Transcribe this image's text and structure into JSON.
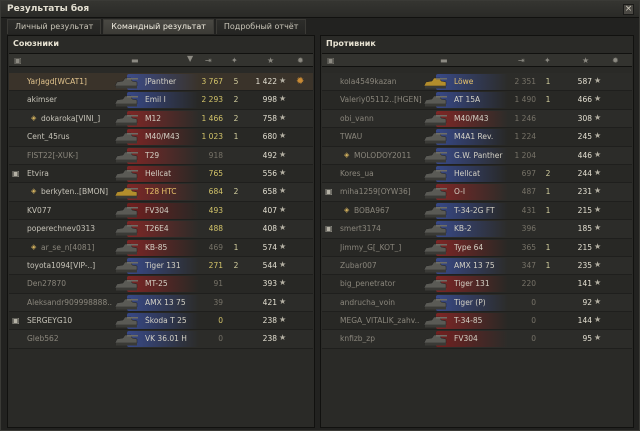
{
  "window": {
    "title": "Результаты боя",
    "close": "×"
  },
  "tabs": [
    {
      "label": "Личный результат",
      "active": false
    },
    {
      "label": "Командный результат",
      "active": true
    },
    {
      "label": "Подробный отчёт",
      "active": false
    }
  ],
  "allies": {
    "title": "Союзники",
    "rows": [
      {
        "name": "YarJagd[WCAT1]",
        "tank": "JPanther",
        "dmg": "3 767",
        "kills": "5",
        "xp": "1 422",
        "star": "★",
        "player": true,
        "medal": "✹",
        "nation": "#3c53a8"
      },
      {
        "name": "akimser",
        "tank": "Emil I",
        "dmg": "2 293",
        "kills": "2",
        "xp": "998",
        "star": "★",
        "nation": "#3c53a8"
      },
      {
        "name": "dokaroka[VINI_]",
        "tank": "M12",
        "dmg": "1 466",
        "kills": "2",
        "xp": "758",
        "star": "★",
        "platoon": true,
        "nation": "#9b2525"
      },
      {
        "name": "Cent_45rus",
        "tank": "M40/M43",
        "dmg": "1 023",
        "kills": "1",
        "xp": "680",
        "star": "★",
        "nation": "#9b2525"
      },
      {
        "name": "FIST22[-XUK-]",
        "tank": "T29",
        "dmg": "918",
        "kills": "",
        "xp": "492",
        "star": "★",
        "dead": true,
        "nation": "#9b2525"
      },
      {
        "name": "Etvira",
        "tank": "Hellcat",
        "dmg": "765",
        "kills": "",
        "xp": "556",
        "star": "★",
        "squad": true,
        "nation": "#9b2525"
      },
      {
        "name": "berkyten..[BMON]",
        "tank": "T28 HTC",
        "dmg": "684",
        "kills": "2",
        "xp": "658",
        "star": "★",
        "platoon": true,
        "elite": true,
        "nation": "#9b2525"
      },
      {
        "name": "KV077",
        "tank": "FV304",
        "dmg": "493",
        "kills": "",
        "xp": "407",
        "star": "★",
        "nation": "#8a1c1c"
      },
      {
        "name": "poperechnev0313",
        "tank": "T26E4",
        "dmg": "488",
        "kills": "",
        "xp": "408",
        "star": "★",
        "nation": "#9b2525"
      },
      {
        "name": "ar_se_n[4081]",
        "tank": "KB-85",
        "dmg": "469",
        "kills": "1",
        "xp": "574",
        "star": "★",
        "platoon": true,
        "dead": true,
        "nation": "#9b2525"
      },
      {
        "name": "toyota1094[VIP-..]",
        "tank": "Tiger 131",
        "dmg": "271",
        "kills": "2",
        "xp": "544",
        "star": "★",
        "nation": "#3c53a8"
      },
      {
        "name": "Den27870",
        "tank": "MT-25",
        "dmg": "91",
        "kills": "",
        "xp": "393",
        "star": "★",
        "dead": true,
        "nation": "#9b2525"
      },
      {
        "name": "Aleksandr909998888..",
        "tank": "AMX 13 75",
        "dmg": "39",
        "kills": "",
        "xp": "421",
        "star": "★",
        "dead": true,
        "nation": "#3c53a8"
      },
      {
        "name": "SERGEYG10",
        "tank": "Škoda T 25",
        "dmg": "0",
        "kills": "",
        "xp": "238",
        "star": "★",
        "squad": true,
        "nation": "#3c53a8"
      },
      {
        "name": "Gleb562",
        "tank": "VK 36.01 H",
        "dmg": "0",
        "kills": "",
        "xp": "238",
        "star": "★",
        "dead": true,
        "nation": "#3c53a8"
      }
    ]
  },
  "enemies": {
    "title": "Противник",
    "rows": [
      {
        "name": "kola4549kazan",
        "tank": "Löwe",
        "dmg": "2 351",
        "kills": "1",
        "xp": "587",
        "star": "★",
        "dead": true,
        "elite": true,
        "nation": "#3c53a8"
      },
      {
        "name": "Valeriy05112..[HGEN]",
        "tank": "AT 15A",
        "dmg": "1 490",
        "kills": "1",
        "xp": "466",
        "star": "★",
        "dead": true,
        "nation": "#3c53a8"
      },
      {
        "name": "obi_vann",
        "tank": "M40/M43",
        "dmg": "1 246",
        "kills": "",
        "xp": "308",
        "star": "★",
        "dead": true,
        "nation": "#9b2525"
      },
      {
        "name": "TWAU",
        "tank": "M4A1 Rev.",
        "dmg": "1 224",
        "kills": "",
        "xp": "245",
        "star": "★",
        "dead": true,
        "nation": "#3c53a8"
      },
      {
        "name": "MOLODOY2011",
        "tank": "G.W. Panther",
        "dmg": "1 204",
        "kills": "",
        "xp": "446",
        "star": "★",
        "platoon": true,
        "dead": true,
        "nation": "#3c53a8"
      },
      {
        "name": "Kores_ua",
        "tank": "Hellcat",
        "dmg": "697",
        "kills": "2",
        "xp": "244",
        "star": "★",
        "dead": true,
        "nation": "#3c53a8"
      },
      {
        "name": "miha1259[OYW36]",
        "tank": "O-I",
        "dmg": "487",
        "kills": "1",
        "xp": "231",
        "star": "★",
        "squad": true,
        "dead": true,
        "nation": "#9b2525"
      },
      {
        "name": "BOBA967",
        "tank": "T-34-2G FT",
        "dmg": "431",
        "kills": "1",
        "xp": "215",
        "star": "★",
        "platoon": true,
        "dead": true,
        "nation": "#3c53a8"
      },
      {
        "name": "smert3174",
        "tank": "KB-2",
        "dmg": "396",
        "kills": "",
        "xp": "185",
        "star": "★",
        "squad": true,
        "dead": true,
        "nation": "#3c53a8"
      },
      {
        "name": "Jimmy_G[_KOT_]",
        "tank": "Type 64",
        "dmg": "365",
        "kills": "1",
        "xp": "215",
        "star": "★",
        "dead": true,
        "nation": "#9b2525"
      },
      {
        "name": "Zubar007",
        "tank": "AMX 13 75",
        "dmg": "347",
        "kills": "1",
        "xp": "235",
        "star": "★",
        "dead": true,
        "nation": "#3c53a8"
      },
      {
        "name": "big_penetrator",
        "tank": "Tiger 131",
        "dmg": "220",
        "kills": "",
        "xp": "141",
        "star": "★",
        "dead": true,
        "nation": "#9b2525"
      },
      {
        "name": "andrucha_voin",
        "tank": "Tiger (P)",
        "dmg": "0",
        "kills": "",
        "xp": "92",
        "star": "★",
        "dead": true,
        "nation": "#3c53a8"
      },
      {
        "name": "MEGA_VITALIK_zahv..",
        "tank": "T-34-85",
        "dmg": "0",
        "kills": "",
        "xp": "144",
        "star": "★",
        "dead": true,
        "nation": "#9b2525"
      },
      {
        "name": "knfizb_zp",
        "tank": "FV304",
        "dmg": "0",
        "kills": "",
        "xp": "95",
        "star": "★",
        "dead": true,
        "nation": "#8a1c1c"
      }
    ]
  },
  "header_icons": {
    "platoon": "▣",
    "tank": "▬",
    "sort": "▼",
    "damage": "⇥",
    "kills": "✦",
    "xp": "★",
    "medal": "✹"
  }
}
